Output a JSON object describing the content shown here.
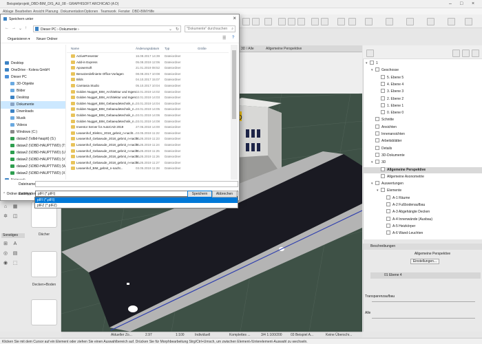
{
  "app": {
    "title": "Beispielprojekt_DBD-BIM_D/S_AU_08 - GRAPHISOFT ARCHICAD (A D)",
    "menu": [
      "Ablage",
      "Bearbeiten",
      "Ansicht",
      "Planung",
      "Dokumentation",
      "Optionen",
      "Teamwork",
      "Fenster",
      "DBD-BIM",
      "Hilfe"
    ]
  },
  "dialog": {
    "title": "Speichern unter",
    "path": "Dieser PC  ›  Dokumente  ›",
    "search_placeholder": "\"Dokumente\" durchsuchen",
    "cmd_organize": "Organisieren ▾",
    "cmd_new_folder": "Neuer Ordner",
    "columns": [
      "Name",
      "Änderungsdatum",
      "Typ",
      "Größe"
    ],
    "tree": [
      {
        "label": "Desktop",
        "color": "#3b82c4"
      },
      {
        "label": "OneDrive - Kolera GmbH",
        "color": "#3b82c4"
      },
      {
        "label": "Dieser PC",
        "color": "#4a90d9"
      },
      {
        "label": "3D-Objekte",
        "color": "#6aa9e0"
      },
      {
        "label": "Bilder",
        "color": "#6aa9e0"
      },
      {
        "label": "Desktop",
        "color": "#3b82c4"
      },
      {
        "label": "Dokumente",
        "color": "#8aa4c4"
      },
      {
        "label": "Downloads",
        "color": "#3b82c4"
      },
      {
        "label": "Musik",
        "color": "#6aa9e0"
      },
      {
        "label": "Videos",
        "color": "#6aa9e0"
      },
      {
        "label": "Windows (C:)",
        "color": "#8a8a8a"
      },
      {
        "label": "dataw2 (\\\\dbd-hauptt) (S:)",
        "color": "#2e9e4f"
      },
      {
        "label": "dataw2 (\\\\DBD-HAUPTTWD) (T:)",
        "color": "#2e9e4f"
      },
      {
        "label": "dataw2 (\\\\DBD-HAUPTTWD) (U:)",
        "color": "#2e9e4f"
      },
      {
        "label": "dataw2 (\\\\DBD-HAUPTTWD) (V:)",
        "color": "#2e9e4f"
      },
      {
        "label": "dataw2 (\\\\DBD-HAUPTTWD) (W:)",
        "color": "#2e9e4f"
      },
      {
        "label": "dataw2 (\\\\DBD-HAUPTTWD) (X:)",
        "color": "#2e9e4f"
      },
      {
        "label": "Netzwerk",
        "color": "#3b82c4"
      }
    ],
    "tree_selected": 6,
    "files": [
      {
        "name": "ActivePresenter",
        "date": "16.08.2017 14:39",
        "type": "Dateiordner"
      },
      {
        "name": "Add-in Express",
        "date": "05.08.2019 12:06",
        "type": "Dateiordner"
      },
      {
        "name": "Apowersoft",
        "date": "21.01.2019 08:52",
        "type": "Dateiordner"
      },
      {
        "name": "Benutzerdefinierte Office-Vorlagen",
        "date": "08.08.2017 10:08",
        "type": "Dateiordner"
      },
      {
        "name": "Bilds",
        "date": "04.10.2017 15:07",
        "type": "Dateiordner"
      },
      {
        "name": "Camtasia Studio",
        "date": "05.10.2017 10:04",
        "type": "Dateiordner"
      },
      {
        "name": "Golden Nugget_BIM_Architektur und Ingen...",
        "date": "03.01.2019 14:02",
        "type": "Dateiordner"
      },
      {
        "name": "Golden Nugget_BIM_Architektur und Ingen...",
        "date": "03.01.2019 14:03",
        "type": "Dateiordner"
      },
      {
        "name": "Golden Nugget_BIM_Gebaeudetechnik_n...",
        "date": "03.01.2019 14:04",
        "type": "Dateiordner"
      },
      {
        "name": "Golden Nugget_BIM_Gebaeudetechnik_n...",
        "date": "03.01.2019 14:05",
        "type": "Dateiordner"
      },
      {
        "name": "Golden Nugget_BIM_Gebaeudetechnik_n...",
        "date": "03.01.2019 14:06",
        "type": "Dateiordner"
      },
      {
        "name": "Golden Nugget_BIM_Gebaeudetechnik_n...",
        "date": "03.01.2019 14:08",
        "type": "Dateiordner"
      },
      {
        "name": "Inventor Server for AutoCAD 2019",
        "date": "27.06.2018 14:00",
        "type": "Dateiordner"
      },
      {
        "name": "Leasenhof_Elektro_2018_gebnit_n-nacht...",
        "date": "03.05.2019 11:22",
        "type": "Dateiordner"
      },
      {
        "name": "Leasenhof_Gebaeude_2018_gebnit_n-nacht...",
        "date": "03.05.2019 11:23",
        "type": "Dateiordner"
      },
      {
        "name": "Leasenhof_Gebaeude_2018_gebnit_n-nacht...",
        "date": "03.05.2019 11:24",
        "type": "Dateiordner"
      },
      {
        "name": "Leasenhof_Gebaeude_2018_gebnit_n-nacht...",
        "date": "03.05.2019 11:25",
        "type": "Dateiordner"
      },
      {
        "name": "Leasenhof_Gebaeude_2018_gebnit_n-nacht...",
        "date": "03.05.2019 11:26",
        "type": "Dateiordner"
      },
      {
        "name": "Leasenhof_Gebaeude_2018_gebnit_n-nacht...",
        "date": "03.05.2019 11:27",
        "type": "Dateiordner"
      },
      {
        "name": "Leasenhof_BIM_gebnit_n-nacht...",
        "date": "03.05.2019 11:28",
        "type": "Dateiordner"
      }
    ],
    "filename_label": "Dateiname:",
    "filename_value": "",
    "filetype_label": "Dateityp:",
    "filetype_value": "pIFI (*.pIFI)",
    "filetype_options": [
      "pIFI (*.pIFI)",
      "pIFZ (*.pIFZ)"
    ],
    "filetype_selected": 0,
    "hide_folders": "Ordner ausblenden",
    "save_button": "Speichern",
    "cancel_button": "Abbrechen"
  },
  "viewport": {
    "tabs": [
      "3D / Alle",
      "Allgemeine Perspektive"
    ]
  },
  "toolbox": {
    "sections": [
      "Sonstiges"
    ],
    "gallery": [
      "Dächer",
      "Decken+Boden"
    ]
  },
  "navigator": {
    "items": [
      {
        "label": "1",
        "indent": 0,
        "tw": "▾"
      },
      {
        "label": "Geschosse",
        "indent": 1,
        "tw": "▾"
      },
      {
        "label": "5. Ebene 5",
        "indent": 2,
        "tw": ""
      },
      {
        "label": "4. Ebene 4",
        "indent": 2,
        "tw": ""
      },
      {
        "label": "3. Ebene 3",
        "indent": 2,
        "tw": ""
      },
      {
        "label": "2. Ebene 2",
        "indent": 2,
        "tw": ""
      },
      {
        "label": "1. Ebene 1",
        "indent": 2,
        "tw": ""
      },
      {
        "label": "0. Ebene 0",
        "indent": 2,
        "tw": ""
      },
      {
        "label": "Schnitte",
        "indent": 1,
        "tw": ""
      },
      {
        "label": "Ansichten",
        "indent": 1,
        "tw": ""
      },
      {
        "label": "Innenansichten",
        "indent": 1,
        "tw": ""
      },
      {
        "label": "Arbeitsblätter",
        "indent": 1,
        "tw": ""
      },
      {
        "label": "Details",
        "indent": 1,
        "tw": ""
      },
      {
        "label": "3D-Dokumente",
        "indent": 1,
        "tw": ""
      },
      {
        "label": "3D",
        "indent": 1,
        "tw": "▾"
      },
      {
        "label": "Allgemeine Perspektive",
        "indent": 2,
        "tw": ""
      },
      {
        "label": "Allgemeine Axonometrie",
        "indent": 2,
        "tw": ""
      },
      {
        "label": "Auswertungen",
        "indent": 1,
        "tw": "▾"
      },
      {
        "label": "Elemente",
        "indent": 2,
        "tw": "▾"
      },
      {
        "label": "A-1 Räume",
        "indent": 3,
        "tw": ""
      },
      {
        "label": "A-2 Fußbodenaufbau",
        "indent": 3,
        "tw": ""
      },
      {
        "label": "A-3 Abgehängte Decken",
        "indent": 3,
        "tw": ""
      },
      {
        "label": "A-4 Innenwände (Ausbau)",
        "indent": 3,
        "tw": ""
      },
      {
        "label": "A-5 Heizkörper",
        "indent": 3,
        "tw": ""
      },
      {
        "label": "A-6 Wand-Leuchten",
        "indent": 3,
        "tw": ""
      }
    ],
    "selected": 15
  },
  "properties": {
    "header": "Beschreibungen",
    "name": "Allgemeine Perspektive",
    "settings_button": "Einstellungen...",
    "row_label": "01 Ebene 4",
    "transparency_label": "Transparenzaufbau",
    "filter_label": "Alle"
  },
  "viewbar": {
    "items": [
      "Aktueller Zo...",
      "2.97",
      "1:100",
      "Individuell",
      "Komplettes ...",
      "3/4 1:100/200",
      "03 Beispiel A...",
      "Keine Überschr..."
    ]
  },
  "status": {
    "text": "Klicken Sie mit dem Cursor auf ein Element oder ziehen Sie einen Auswahlbereich auf. Drücken Sie für Morphbearbeitung Strg/Ctrl+Umsch, um zwischen Element-/Unterelement-Auswahl zu wechseln."
  },
  "colors": {
    "accent": "#0078d7",
    "ground": "#3e5146",
    "road": "#1a1a22",
    "sidewalk": "#b4b4b4"
  }
}
